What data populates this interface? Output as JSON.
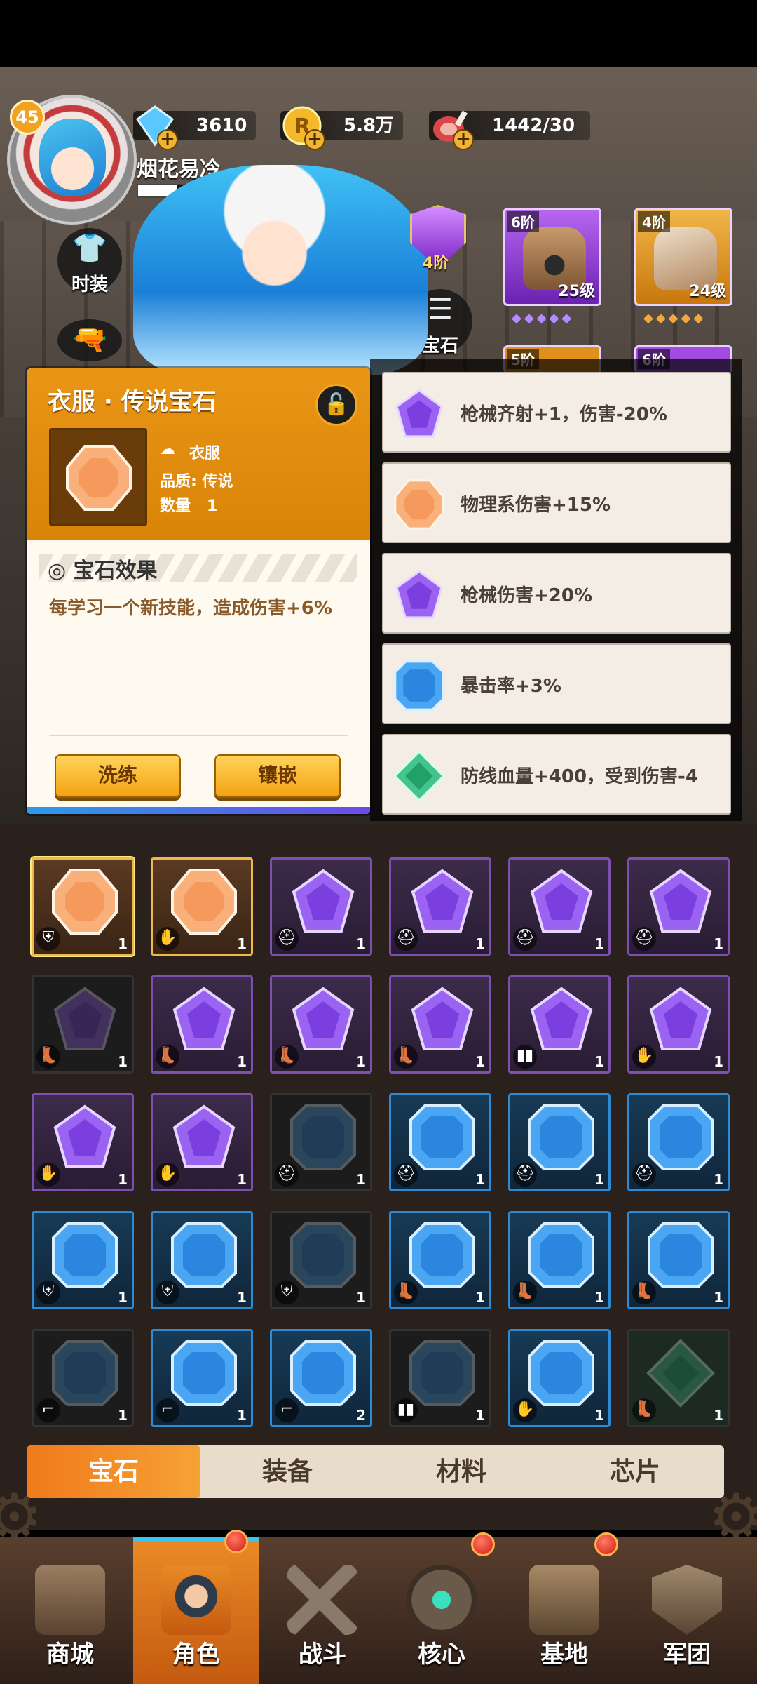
{
  "header": {
    "level": "45",
    "player_name": "烟花易冷",
    "resources": [
      {
        "icon": "diamond-icon",
        "value": "3610"
      },
      {
        "icon": "gold-coin-icon",
        "value": "5.8万"
      },
      {
        "icon": "meat-stamina-icon",
        "value": "1442/30"
      }
    ]
  },
  "side_buttons": {
    "costume_label": "时装",
    "gem_label": "宝石"
  },
  "equipment": {
    "shield_tier": "4阶",
    "slots": [
      {
        "tier": "6阶",
        "level": "25级",
        "icon": "helmet-icon",
        "color": "#a24be0"
      },
      {
        "tier": "4阶",
        "level": "24级",
        "icon": "gauntlet-icon",
        "color": "#e0901b"
      },
      {
        "tier": "5阶",
        "level": "",
        "icon": "armor-icon",
        "color": "#e0901b"
      },
      {
        "tier": "6阶",
        "level": "",
        "icon": "boots-icon",
        "color": "#a24be0"
      }
    ]
  },
  "popup": {
    "title": "衣服 · 传说宝石",
    "slot_name": "衣服",
    "quality_label": "品质:",
    "quality_value": "传说",
    "count_label": "数量",
    "count_value": "1",
    "effect_title": "宝石效果",
    "effect_text": "每学习一个新技能，造成伤害+6%",
    "btn_refine": "洗练",
    "btn_inlay": "镶嵌"
  },
  "attributes": [
    {
      "gem": "purple",
      "text": "枪械齐射+1，伤害-20%"
    },
    {
      "gem": "orange",
      "text": "物理系伤害+15%"
    },
    {
      "gem": "purple",
      "text": "枪械伤害+20%"
    },
    {
      "gem": "blue",
      "text": "暴击率+3%"
    },
    {
      "gem": "green",
      "text": "防线血量+400，受到伤害-4"
    }
  ],
  "inventory": [
    {
      "gem": "orange",
      "slot": "armor",
      "count": "1",
      "state": "selected"
    },
    {
      "gem": "orange",
      "slot": "glove",
      "count": "1",
      "state": "normal"
    },
    {
      "gem": "purple",
      "slot": "helmet",
      "count": "1",
      "state": "normal"
    },
    {
      "gem": "purple",
      "slot": "helmet",
      "count": "1",
      "state": "normal"
    },
    {
      "gem": "purple",
      "slot": "helmet",
      "count": "1",
      "state": "normal"
    },
    {
      "gem": "purple",
      "slot": "helmet",
      "count": "1",
      "state": "normal"
    },
    {
      "gem": "purple",
      "slot": "boots",
      "count": "1",
      "state": "dim"
    },
    {
      "gem": "purple",
      "slot": "boots",
      "count": "1",
      "state": "normal"
    },
    {
      "gem": "purple",
      "slot": "boots",
      "count": "1",
      "state": "normal"
    },
    {
      "gem": "purple",
      "slot": "boots",
      "count": "1",
      "state": "normal"
    },
    {
      "gem": "purple",
      "slot": "pants",
      "count": "1",
      "state": "normal"
    },
    {
      "gem": "purple",
      "slot": "glove",
      "count": "1",
      "state": "normal"
    },
    {
      "gem": "purple",
      "slot": "glove",
      "count": "1",
      "state": "normal"
    },
    {
      "gem": "purple",
      "slot": "glove",
      "count": "1",
      "state": "normal"
    },
    {
      "gem": "blue",
      "slot": "helmet",
      "count": "1",
      "state": "dim"
    },
    {
      "gem": "blue",
      "slot": "helmet",
      "count": "1",
      "state": "normal"
    },
    {
      "gem": "blue",
      "slot": "helmet",
      "count": "1",
      "state": "normal"
    },
    {
      "gem": "blue",
      "slot": "helmet",
      "count": "1",
      "state": "normal"
    },
    {
      "gem": "blue",
      "slot": "armor",
      "count": "1",
      "state": "normal"
    },
    {
      "gem": "blue",
      "slot": "armor",
      "count": "1",
      "state": "normal"
    },
    {
      "gem": "blue",
      "slot": "armor",
      "count": "1",
      "state": "dim"
    },
    {
      "gem": "blue",
      "slot": "boots",
      "count": "1",
      "state": "normal"
    },
    {
      "gem": "blue",
      "slot": "boots",
      "count": "1",
      "state": "normal"
    },
    {
      "gem": "blue",
      "slot": "boots",
      "count": "1",
      "state": "normal"
    },
    {
      "gem": "blue",
      "slot": "gun",
      "count": "1",
      "state": "dim"
    },
    {
      "gem": "blue",
      "slot": "gun",
      "count": "1",
      "state": "normal"
    },
    {
      "gem": "blue",
      "slot": "gun",
      "count": "2",
      "state": "normal"
    },
    {
      "gem": "blue",
      "slot": "pants",
      "count": "1",
      "state": "dim"
    },
    {
      "gem": "blue",
      "slot": "glove",
      "count": "1",
      "state": "normal"
    },
    {
      "gem": "green",
      "slot": "boots",
      "count": "1",
      "state": "dim"
    }
  ],
  "tabs": [
    "宝石",
    "装备",
    "材料",
    "芯片"
  ],
  "nav": [
    {
      "label": "商城",
      "badge": false
    },
    {
      "label": "角色",
      "badge": true
    },
    {
      "label": "战斗",
      "badge": false
    },
    {
      "label": "核心",
      "badge": true
    },
    {
      "label": "基地",
      "badge": true
    },
    {
      "label": "军团",
      "badge": false
    }
  ],
  "colors": {
    "accent_orange": "#f08a1c",
    "gem_purple": "#8b4fe8",
    "gem_orange": "#f5a570",
    "gem_blue": "#3c9bf0",
    "gem_green": "#3fbf7a"
  }
}
